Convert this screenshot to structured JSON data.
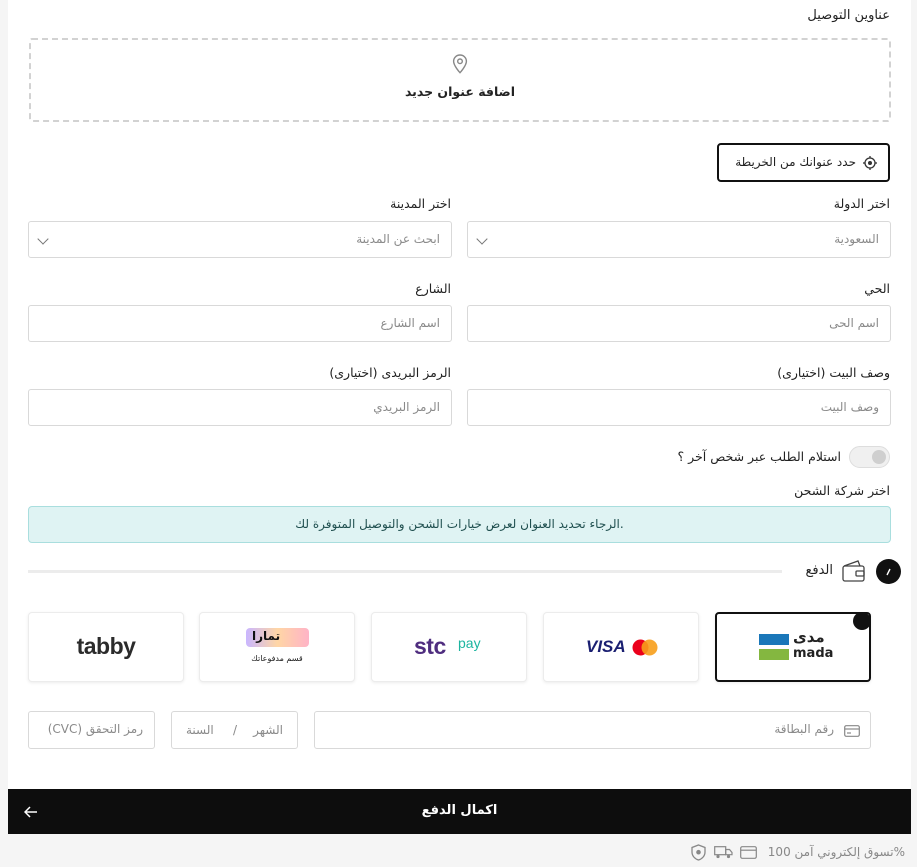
{
  "address": {
    "section_title": "عناوين التوصيل",
    "add_new_label": "اضافة عنوان جديد",
    "map_button_label": "حدد عنوانك من الخريطة"
  },
  "form": {
    "country_label": "اختر الدولة",
    "country_value": "السعودية",
    "city_label": "اختر المدينة",
    "city_placeholder": "ابحث عن المدينة",
    "district_label": "الحي",
    "district_placeholder": "اسم الحى",
    "street_label": "الشارع",
    "street_placeholder": "اسم الشارع",
    "house_label": "وصف البيت (اختيارى)",
    "house_placeholder": "وصف البيت",
    "postal_label": "الرمز البريدى (اختيارى)",
    "postal_placeholder": "الرمز البريدي",
    "other_person_label": "استلام الطلب عبر شخص آخر ؟",
    "other_person_enabled": false
  },
  "shipping": {
    "title": "اختر شركة الشحن",
    "notice": "الرجاء تحديد العنوان لعرض خيارات الشحن والتوصيل المتوفرة لك."
  },
  "payment": {
    "title": "الدفع",
    "methods": [
      {
        "id": "mada",
        "label_ar": "مدى",
        "label_en": "mada",
        "selected": true
      },
      {
        "id": "visa-mastercard",
        "label": "VISA",
        "selected": false
      },
      {
        "id": "stcpay",
        "label": "stc",
        "label2": "pay",
        "selected": false
      },
      {
        "id": "tamara",
        "label": "تمارا",
        "sub": "قسم مدفوعاتك",
        "selected": false
      },
      {
        "id": "tabby",
        "label": "tabby",
        "selected": false
      }
    ],
    "card_number_placeholder": "رقم البطاقة",
    "month_placeholder": "الشهر",
    "separator": "/",
    "year_placeholder": "السنة",
    "cvc_placeholder": "(CVC) رمز التحقق"
  },
  "checkout": {
    "button_label": "اكمال الدفع",
    "secure_text": "تسوق إلكتروني آمن 100%"
  },
  "colors": {
    "notice_bg": "#dff3f3",
    "notice_border": "#a9dede",
    "button_bg": "#0d0d0d",
    "mada_blue": "#1a77b9",
    "mada_green": "#84b740",
    "stc_purple": "#4f2d7f",
    "stc_green": "#1db5a0",
    "visa_blue": "#1a1f71"
  }
}
